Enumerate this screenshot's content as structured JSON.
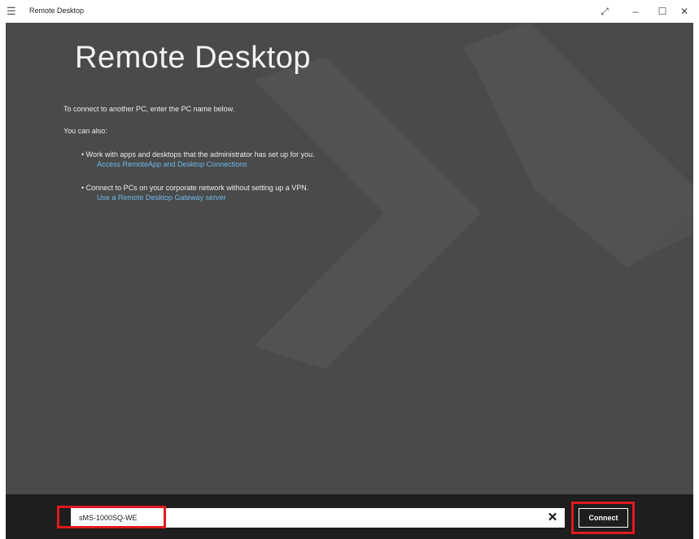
{
  "window": {
    "title": "Remote Desktop",
    "menu_icon": "hamburger-icon",
    "controls": {
      "fullscreen_icon": "expand-icon",
      "minimize_icon": "minimize-icon",
      "maximize_icon": "maximize-icon",
      "close_icon": "close-icon"
    }
  },
  "main": {
    "heading": "Remote Desktop",
    "intro": "To connect to another PC, enter the PC name below.",
    "also": "You can also:",
    "bullets": [
      {
        "text": "Work with apps and desktops that the administrator has set up for you.",
        "link": "Access RemoteApp and Desktop Connections"
      },
      {
        "text": "Connect to PCs on your corporate network without setting up a VPN.",
        "link": "Use a Remote Desktop Gateway server"
      }
    ]
  },
  "bottom": {
    "pc_name_value": "sMS-1000SQ-WE",
    "clear_icon": "clear-icon",
    "connect_label": "Connect"
  },
  "colors": {
    "content_bg": "#4a4a4a",
    "bottom_bar_bg": "#1e1e1e",
    "link": "#6eb8e6",
    "highlight": "#e0191f"
  }
}
